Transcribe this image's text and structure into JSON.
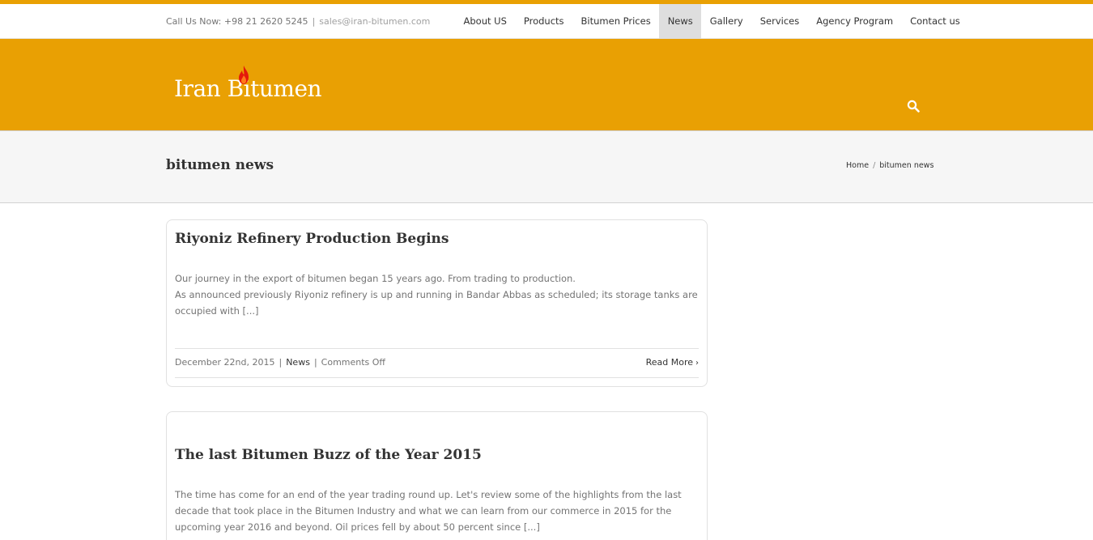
{
  "topbar": {
    "phone_text": "Call Us Now: +98 21 2620 5245",
    "separator": "|",
    "email": "sales@iran-bitumen.com",
    "nav": [
      {
        "label": "About US"
      },
      {
        "label": "Products"
      },
      {
        "label": "Bitumen Prices"
      },
      {
        "label": "News"
      },
      {
        "label": "Gallery"
      },
      {
        "label": "Services"
      },
      {
        "label": "Agency Program"
      },
      {
        "label": "Contact us"
      }
    ],
    "active_nav": "News"
  },
  "header": {
    "logo_text": "Iran Bitumen",
    "search_icon": "search-icon",
    "background_color": "#e9a003"
  },
  "title_bar": {
    "title": "bitumen news",
    "breadcrumb": {
      "home": "Home",
      "separator": "/",
      "current": "bitumen news"
    }
  },
  "posts": [
    {
      "title": "Riyoniz Refinery Production Begins",
      "excerpt_line1": "Our journey in the export of bitumen began 15 years ago. From trading to production.",
      "excerpt_line2": "As announced previously Riyoniz refinery is up and running in Bandar Abbas as scheduled; its storage tanks are occupied with [...]",
      "date": "December 22nd, 2015",
      "category": "News",
      "comments": "Comments Off",
      "read_more": "Read More"
    },
    {
      "title": "The last Bitumen Buzz of the Year 2015",
      "excerpt": "The time has come for an end of the year trading round up. Let's review some of the highlights from the last decade that took place in the Bitumen Industry and what we can learn from our commerce in 2015 for the upcoming year 2016 and beyond. Oil prices fell by about 50 percent since [...]"
    }
  ]
}
